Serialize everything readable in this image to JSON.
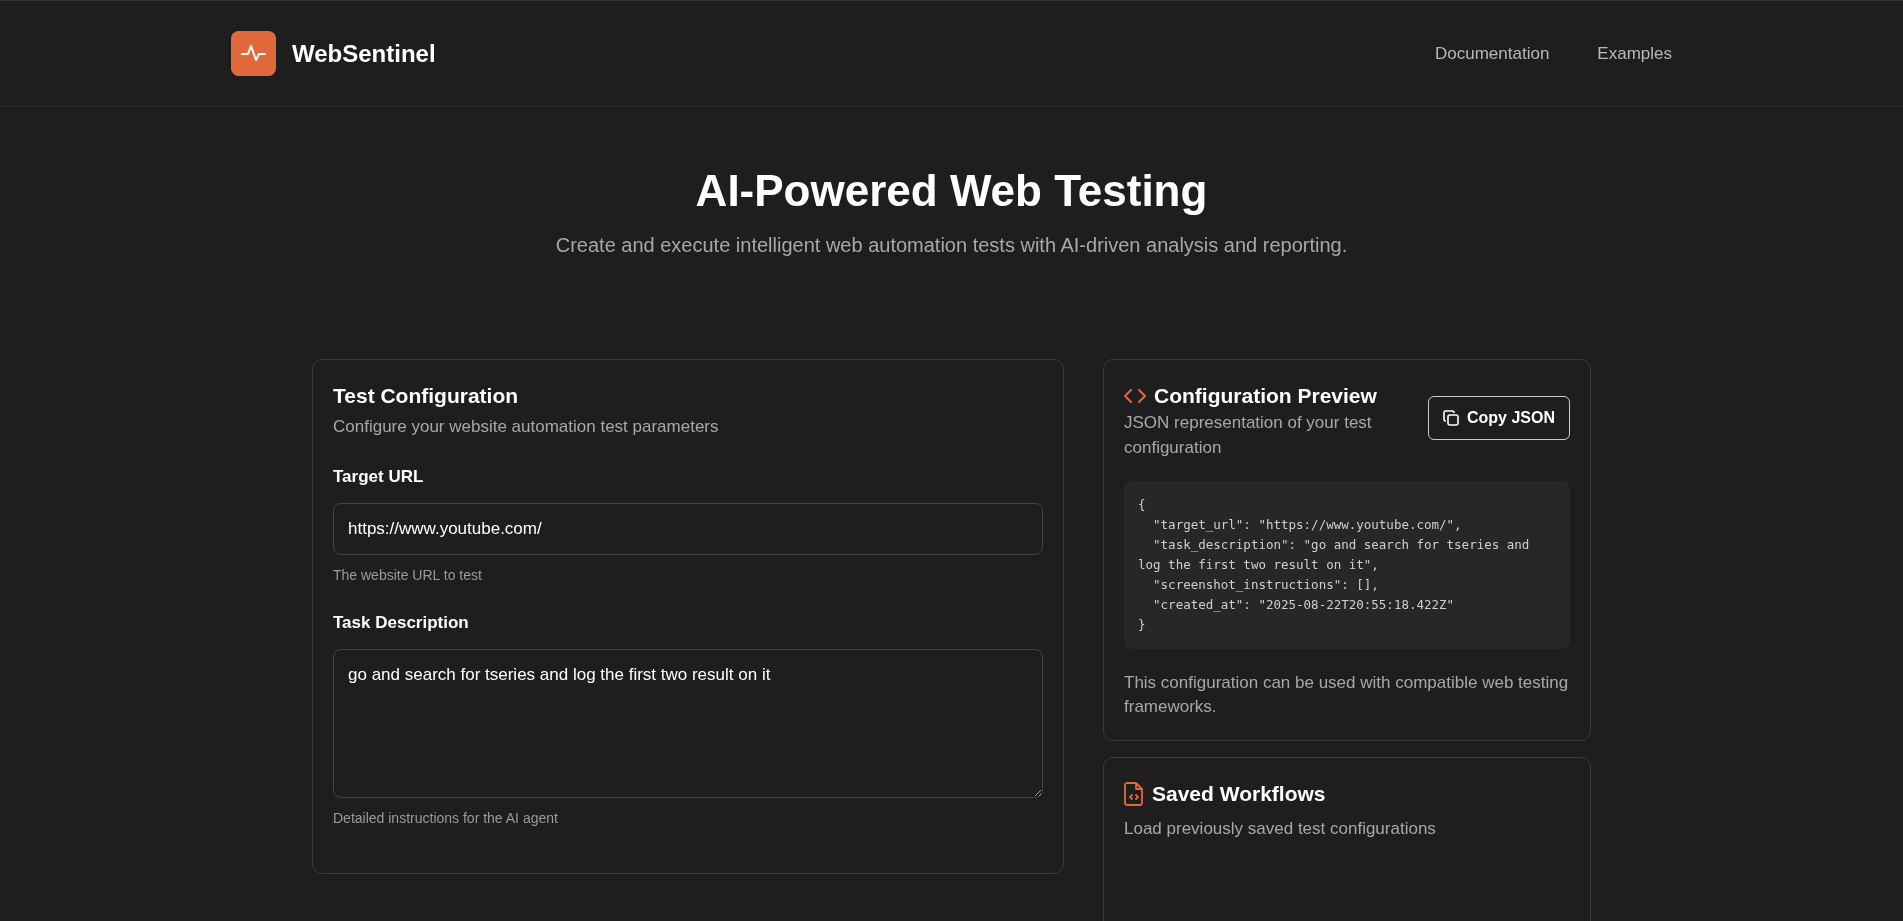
{
  "header": {
    "brand": "WebSentinel",
    "nav": [
      "Documentation",
      "Examples"
    ]
  },
  "hero": {
    "title": "AI-Powered Web Testing",
    "subtitle": "Create and execute intelligent web automation tests with AI-driven analysis and reporting."
  },
  "test_configuration": {
    "title": "Test Configuration",
    "subtitle": "Configure your website automation test parameters",
    "fields": [
      {
        "kind": "input",
        "label": "Target URL",
        "value": "https://www.youtube.com/",
        "help": "The website URL to test"
      },
      {
        "kind": "textarea",
        "label": "Task Description",
        "value": "go and search for tseries and log the first two result on it",
        "help": "Detailed instructions for the AI agent"
      }
    ]
  },
  "configuration_preview": {
    "title": "Configuration Preview",
    "subtitle": "JSON representation of your test configuration",
    "button": "Copy JSON",
    "code": "{\n  \"target_url\": \"https://www.youtube.com/\",\n  \"task_description\": \"go and search for tseries and log the first two result on it\",\n  \"screenshot_instructions\": [],\n  \"created_at\": \"2025-08-22T20:55:18.422Z\"\n}",
    "note": "This configuration can be used with compatible web testing frameworks."
  },
  "saved_workflows": {
    "title": "Saved Workflows",
    "subtitle": "Load previously saved test configurations"
  }
}
